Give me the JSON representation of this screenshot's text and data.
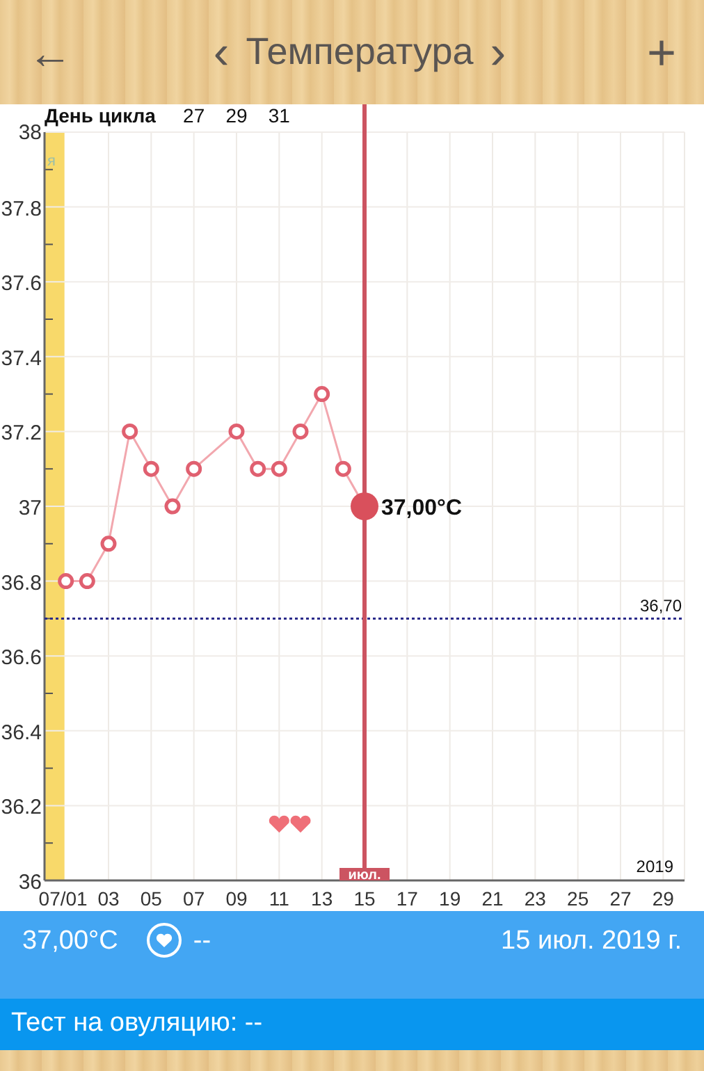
{
  "header": {
    "title": "Температура",
    "back": "←",
    "prev": "‹",
    "next": "›",
    "add": "+"
  },
  "chart": {
    "cycle_day_label": "День цикла",
    "cycle_days": [
      "27",
      "29",
      "31"
    ],
    "band_label": "я",
    "year_label": "2019",
    "chart_data": {
      "type": "line",
      "grid": true,
      "x": [
        1,
        2,
        3,
        4,
        5,
        6,
        7,
        9,
        10,
        11,
        12,
        13,
        14,
        15
      ],
      "series": [
        {
          "color": "#e06070",
          "marker": "o",
          "values": [
            36.8,
            36.8,
            36.9,
            37.2,
            37.1,
            37.0,
            37.1,
            37.2,
            37.1,
            37.1,
            37.2,
            37.3,
            37.1,
            37.0
          ]
        }
      ],
      "xlim": [
        0,
        30
      ],
      "ylim": [
        36,
        38
      ],
      "xticks": [
        {
          "value": 1,
          "label": "07/01"
        },
        {
          "value": 3,
          "label": "03"
        },
        {
          "value": 5,
          "label": "05"
        },
        {
          "value": 7,
          "label": "07"
        },
        {
          "value": 9,
          "label": "09"
        },
        {
          "value": 11,
          "label": "11"
        },
        {
          "value": 13,
          "label": "13"
        },
        {
          "value": 15,
          "label": "15"
        },
        {
          "value": 17,
          "label": "17"
        },
        {
          "value": 19,
          "label": "19"
        },
        {
          "value": 21,
          "label": "21"
        },
        {
          "value": 23,
          "label": "23"
        },
        {
          "value": 25,
          "label": "25"
        },
        {
          "value": 27,
          "label": "27"
        },
        {
          "value": 29,
          "label": "29"
        }
      ],
      "yticks": [
        {
          "value": 36,
          "label": "36"
        },
        {
          "value": 36.2,
          "label": "36.2"
        },
        {
          "value": 36.4,
          "label": "36.4"
        },
        {
          "value": 36.6,
          "label": "36.6"
        },
        {
          "value": 36.8,
          "label": "36.8"
        },
        {
          "value": 37,
          "label": "37"
        },
        {
          "value": 37.2,
          "label": "37.2"
        },
        {
          "value": 37.4,
          "label": "37.4"
        },
        {
          "value": 37.6,
          "label": "37.6"
        },
        {
          "value": 37.8,
          "label": "37.8"
        },
        {
          "value": 38,
          "label": "38"
        }
      ],
      "bands": [
        {
          "axis": "x",
          "from": 0,
          "to": 1,
          "color": "#f8d96a"
        }
      ],
      "ref_lines": [
        {
          "axis": "y",
          "value": 36.7,
          "label": "36,70",
          "color": "#2a2a8a"
        },
        {
          "axis": "x",
          "value": 15,
          "label": "июл.",
          "color": "#cc5461"
        }
      ],
      "annotations": [
        {
          "x": 15,
          "y": 37,
          "text": "37,00°C"
        }
      ]
    }
  },
  "info": {
    "temperature": "37,00°C",
    "sex": "--",
    "date": "15 июл. 2019 г."
  },
  "ovulation": {
    "text": "Тест на овуляцию: --"
  }
}
